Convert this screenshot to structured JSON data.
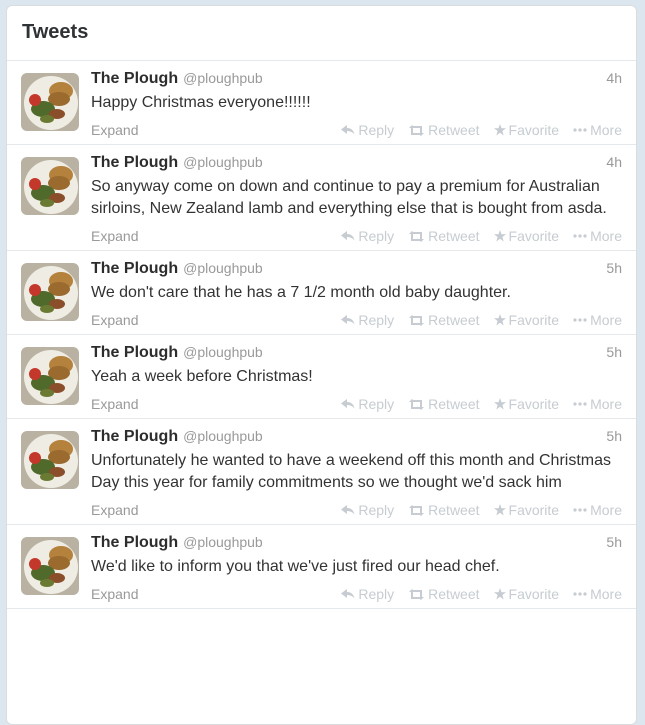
{
  "panel": {
    "title": "Tweets"
  },
  "tweets": [
    {
      "name": "The Plough",
      "handle": "@ploughpub",
      "time": "4h",
      "text": "Happy Christmas everyone!!!!!!",
      "expand": "Expand"
    },
    {
      "name": "The Plough",
      "handle": "@ploughpub",
      "time": "4h",
      "text": "So anyway come on down and continue to pay a premium for Australian sirloins, New Zealand lamb and everything else that is bought from asda.",
      "expand": "Expand"
    },
    {
      "name": "The Plough",
      "handle": "@ploughpub",
      "time": "5h",
      "text": "We don't care that he has a 7 1/2 month old baby daughter.",
      "expand": "Expand"
    },
    {
      "name": "The Plough",
      "handle": "@ploughpub",
      "time": "5h",
      "text": "Yeah a week before Christmas!",
      "expand": "Expand"
    },
    {
      "name": "The Plough",
      "handle": "@ploughpub",
      "time": "5h",
      "text": "Unfortunately he wanted to have a weekend off this month and Christmas Day this year for family commitments so we thought we'd sack him",
      "expand": "Expand"
    },
    {
      "name": "The Plough",
      "handle": "@ploughpub",
      "time": "5h",
      "text": "We'd like to inform you that we've just fired our head chef.",
      "expand": "Expand"
    }
  ],
  "actions": {
    "reply": "Reply",
    "retweet": "Retweet",
    "favorite": "Favorite",
    "more": "More"
  },
  "icons": {
    "reply": "reply-arrow-icon",
    "retweet": "retweet-icon",
    "favorite": "star-icon",
    "more": "ellipsis-icon"
  },
  "colors": {
    "muted": "#999999",
    "action": "#c6ccd1",
    "background": "#dbe6ee"
  }
}
